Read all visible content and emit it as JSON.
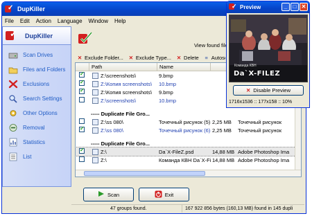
{
  "app": {
    "title": "DupKiller"
  },
  "menu": [
    "File",
    "Edit",
    "Action",
    "Language",
    "Window",
    "Help"
  ],
  "sidebar": {
    "title": "DupKiller",
    "items": [
      {
        "label": "Scan Drives",
        "icon": "scan-drives-icon"
      },
      {
        "label": "Files and Folders",
        "icon": "folder-icon"
      },
      {
        "label": "Exclusions",
        "icon": "exclusion-x-icon"
      },
      {
        "label": "Search Settings",
        "icon": "search-settings-icon"
      },
      {
        "label": "Other Options",
        "icon": "options-icon"
      },
      {
        "label": "Removal",
        "icon": "removal-icon"
      },
      {
        "label": "Statistics",
        "icon": "statistics-icon"
      },
      {
        "label": "List",
        "icon": "list-icon"
      }
    ]
  },
  "header": {
    "found_text": "View found files"
  },
  "toolbar": {
    "exclude_folder": "Exclude Folder...",
    "exclude_type": "Exclude Type...",
    "delete": "Delete",
    "autoselect": "Autose"
  },
  "table": {
    "columns": [
      "",
      "Path",
      "Name",
      "",
      ""
    ],
    "rows": [
      {
        "kind": "file",
        "checked": true,
        "path": "Z:\\screenshots\\",
        "name": "9.bmp",
        "size": "",
        "type": "",
        "blue": false
      },
      {
        "kind": "file",
        "checked": true,
        "path": "Z:\\Копия screenshots\\",
        "name": "10.bmp",
        "size": "",
        "type": "",
        "blue": true
      },
      {
        "kind": "file",
        "checked": true,
        "path": "Z:\\Копия screenshots\\",
        "name": "9.bmp",
        "size": "",
        "type": "",
        "blue": false
      },
      {
        "kind": "file",
        "checked": false,
        "path": "Z:\\screenshots\\",
        "name": "10.bmp",
        "size": "",
        "type": "",
        "blue": true
      },
      {
        "kind": "spacer"
      },
      {
        "kind": "group",
        "path": "----- Duplicate File Gro...",
        "name": "",
        "size": "",
        "type": ""
      },
      {
        "kind": "file",
        "checked": false,
        "path": "Z:\\ss 080\\",
        "name": "Точечный рисунок (5).bmp",
        "size": "2,25 MB",
        "type": "Точечный рисунок",
        "blue": false
      },
      {
        "kind": "file",
        "checked": true,
        "path": "Z:\\ss 080\\",
        "name": "Точечный рисунок (6).bmp",
        "size": "2,25 MB",
        "type": "Точечный рисунок",
        "blue": true
      },
      {
        "kind": "spacer"
      },
      {
        "kind": "group",
        "path": "----- Duplicate File Gro...",
        "name": "",
        "size": "",
        "type": ""
      },
      {
        "kind": "file",
        "checked": true,
        "selected": true,
        "path": "Z:\\",
        "name": "Da`X-FileZ.psd",
        "size": "14,88 MB",
        "type": "Adobe Photoshop Ima",
        "blue": false
      },
      {
        "kind": "file",
        "checked": false,
        "path": "Z:\\",
        "name": "Команда КВН Da`X-Filez.psd",
        "size": "14,88 MB",
        "type": "Adobe Photoshop Ima",
        "blue": false
      }
    ]
  },
  "buttons": {
    "scan": "Scan",
    "exit": "Exit"
  },
  "status": {
    "groups": "47 groups found.",
    "bytes": "167 922 856 bytes (160,13 MB) found in 145 dupli"
  },
  "preview": {
    "title": "Preview",
    "image_caption": "Da`X-FILEZ",
    "image_small": "Команда КВН",
    "disable_button": "Disable Preview",
    "info": "1716x1536 :: 177x158 :: 10%"
  },
  "colors": {
    "titlebar": "#0544c8",
    "nav_text": "#215dc6",
    "accent_red": "#d21f1f"
  }
}
